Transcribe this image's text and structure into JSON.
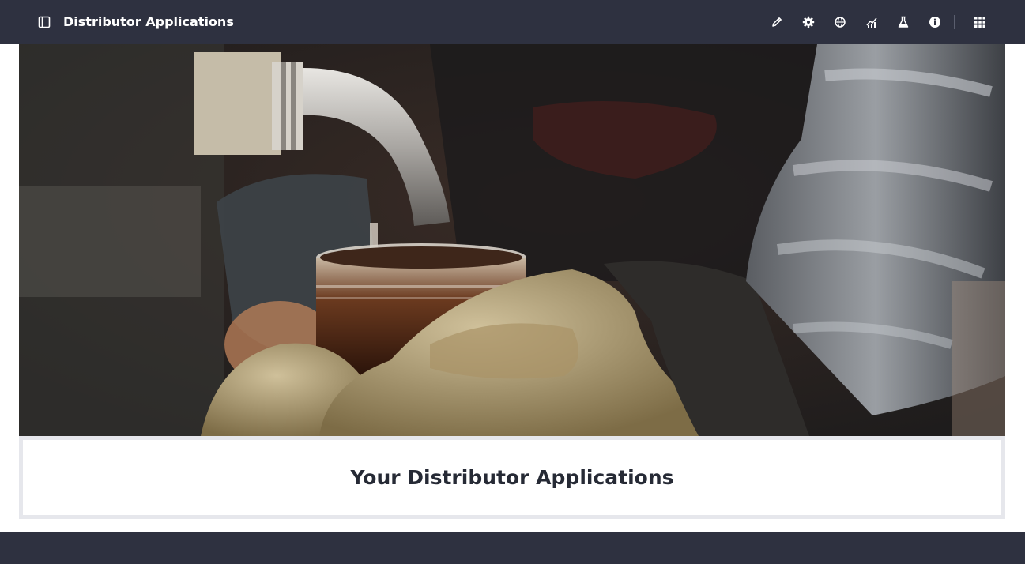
{
  "header": {
    "app_title": "Distributor Applications",
    "icons": [
      "sidebar-toggle-icon",
      "pencil-icon",
      "gear-icon",
      "globe-icon",
      "chart-icon",
      "flask-icon",
      "info-icon",
      "apps-grid-icon"
    ]
  },
  "hero": {
    "image_subject": "syrup pouring from a metal pipe into a glass jar held by gloved hands"
  },
  "main": {
    "heading": "Your Distributor Applications"
  },
  "colors": {
    "topbar": "#2e3140",
    "card_border": "#e6e7ec",
    "heading_text": "#262a35"
  }
}
